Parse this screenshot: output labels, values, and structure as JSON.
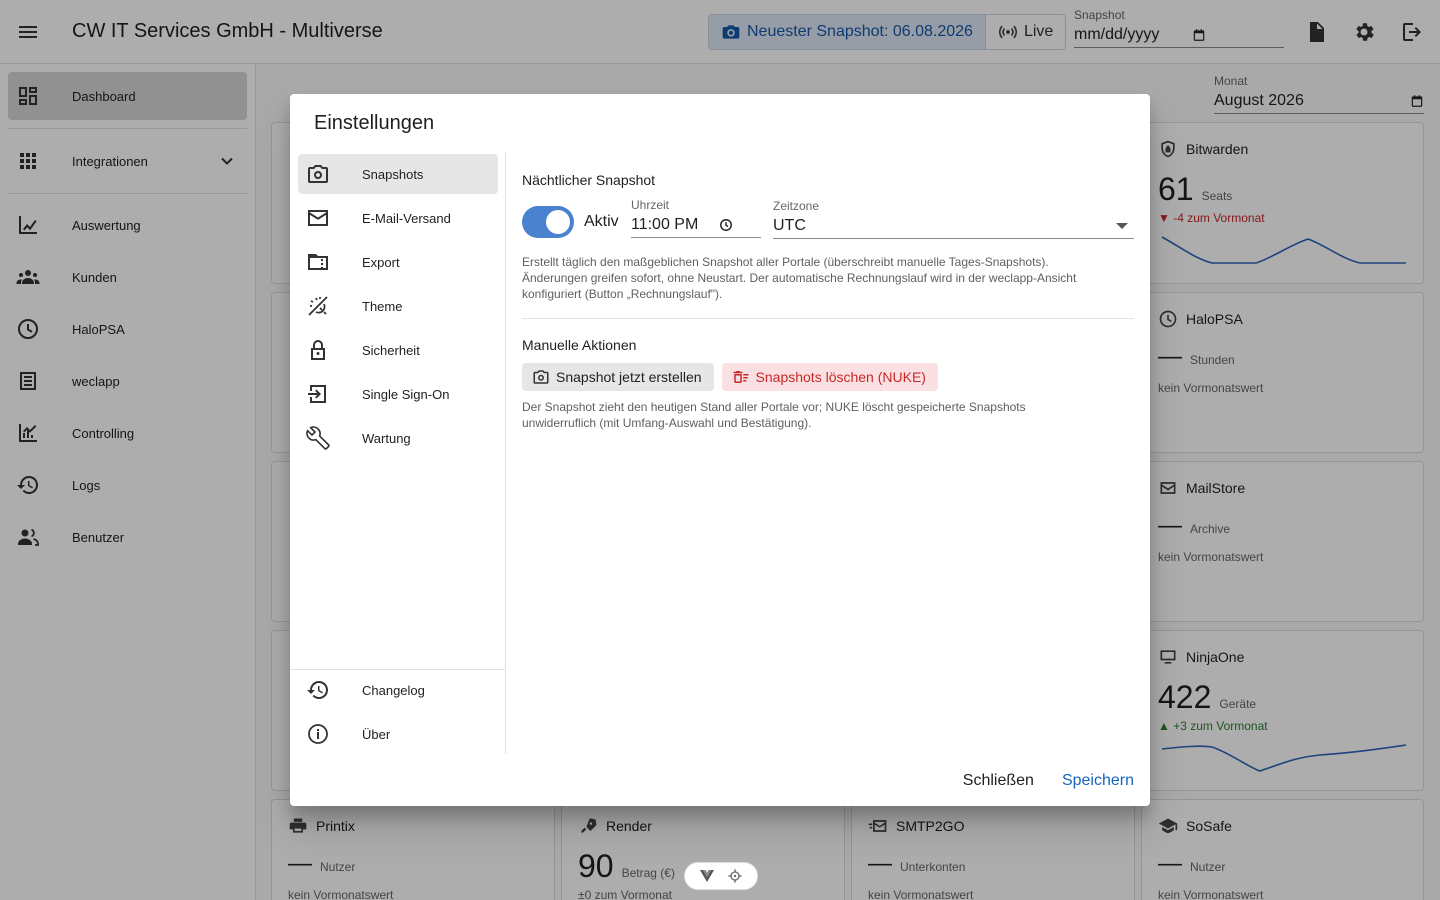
{
  "app": {
    "title": "CW IT Services GmbH - Multiverse",
    "snapshot_button": "Neuester Snapshot: 06.08.2026",
    "live_button": "Live",
    "snapshot_field_label": "Snapshot",
    "snapshot_field_placeholder": "mm/dd/yyyy"
  },
  "sidebar": {
    "items": [
      {
        "label": "Dashboard",
        "icon": "dashboard-icon"
      },
      {
        "label": "Integrationen",
        "icon": "apps-icon"
      },
      {
        "label": "Auswertung",
        "icon": "chart-icon"
      },
      {
        "label": "Kunden",
        "icon": "people-icon"
      },
      {
        "label": "HaloPSA",
        "icon": "clock-icon"
      },
      {
        "label": "weclapp",
        "icon": "list-icon"
      },
      {
        "label": "Controlling",
        "icon": "analytics-icon"
      },
      {
        "label": "Logs",
        "icon": "history-icon"
      },
      {
        "label": "Benutzer",
        "icon": "users-icon"
      }
    ]
  },
  "month": {
    "label": "Monat",
    "value": "August 2026"
  },
  "cards": {
    "bitwarden": {
      "name": "Bitwarden",
      "value": "61",
      "unit": "Seats",
      "delta": "▼ -4 zum Vormonat"
    },
    "halopsa": {
      "name": "HaloPSA",
      "value": "—",
      "unit": "Stunden",
      "delta": "kein Vormonatswert"
    },
    "mailstore": {
      "name": "MailStore",
      "value": "—",
      "unit": "Archive",
      "delta": "kein Vormonatswert"
    },
    "ninjaone": {
      "name": "NinjaOne",
      "value": "422",
      "unit": "Geräte",
      "delta": "▲ +3 zum Vormonat"
    },
    "printix": {
      "name": "Printix",
      "value": "—",
      "unit": "Nutzer",
      "delta": "kein Vormonatswert"
    },
    "render": {
      "name": "Render",
      "value": "90",
      "unit": "Betrag (€)",
      "delta": "±0 zum Vormonat"
    },
    "smtp2go": {
      "name": "SMTP2GO",
      "value": "—",
      "unit": "Unterkonten",
      "delta": "kein Vormonatswert"
    },
    "sosafe": {
      "name": "SoSafe",
      "value": "—",
      "unit": "Nutzer",
      "delta": "kein Vormonatswert"
    }
  },
  "dialog": {
    "title": "Einstellungen",
    "nav": [
      {
        "label": "Snapshots",
        "icon": "camera-icon"
      },
      {
        "label": "E-Mail-Versand",
        "icon": "mail-icon"
      },
      {
        "label": "Export",
        "icon": "folder-icon"
      },
      {
        "label": "Theme",
        "icon": "theme-icon"
      },
      {
        "label": "Sicherheit",
        "icon": "lock-icon"
      },
      {
        "label": "Single Sign-On",
        "icon": "login-icon"
      },
      {
        "label": "Wartung",
        "icon": "wrench-icon"
      }
    ],
    "nav_bottom": [
      {
        "label": "Changelog",
        "icon": "history-icon"
      },
      {
        "label": "Über",
        "icon": "info-icon"
      }
    ],
    "nightly": {
      "title": "Nächtlicher Snapshot",
      "toggle_label": "Aktiv",
      "time_label": "Uhrzeit",
      "time_value": "11:00 PM",
      "tz_label": "Zeitzone",
      "tz_value": "UTC",
      "help_line1": "Erstellt täglich den maßgeblichen Snapshot aller Portale (überschreibt manuelle Tages-Snapshots).",
      "help_line2": "Änderungen greifen sofort, ohne Neustart. Der automatische Rechnungslauf wird in der weclapp-Ansicht",
      "help_line3": "konfiguriert (Button „Rechnungslauf\")."
    },
    "manual": {
      "title": "Manuelle Aktionen",
      "create_button": "Snapshot jetzt erstellen",
      "nuke_button": "Snapshots löschen (NUKE)",
      "help_line1": "Der Snapshot zieht den heutigen Stand aller Portale vor; NUKE löscht gespeicherte Snapshots",
      "help_line2": "unwiderruflich (mit Umfang-Auswahl und Bestätigung)."
    },
    "close_button": "Schließen",
    "save_button": "Speichern"
  }
}
